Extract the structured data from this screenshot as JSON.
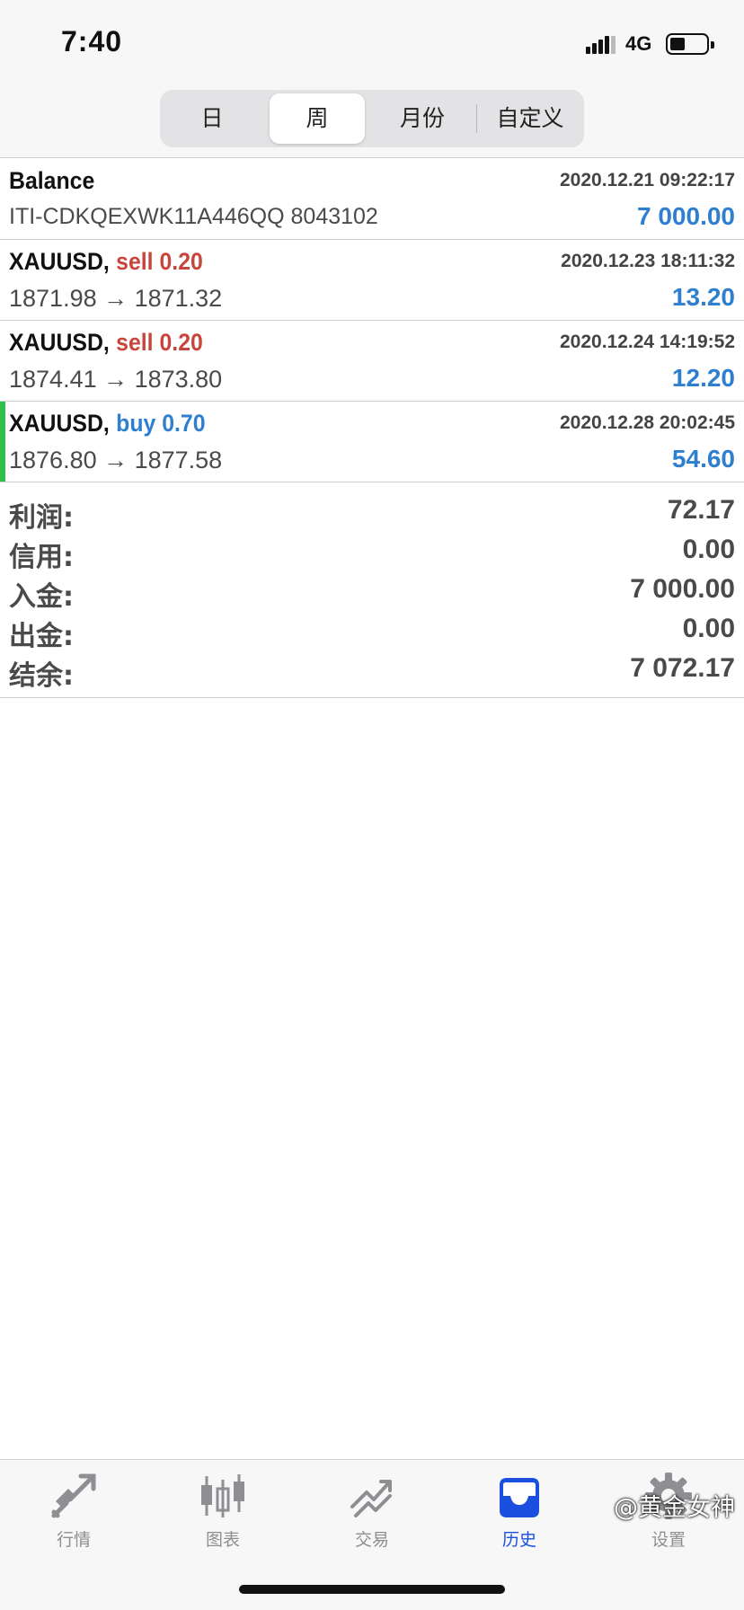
{
  "status": {
    "time": "7:40",
    "network": "4G"
  },
  "segments": [
    {
      "label": "日",
      "active": false
    },
    {
      "label": "周",
      "active": true
    },
    {
      "label": "月份",
      "active": false
    },
    {
      "label": "自定义",
      "active": false
    }
  ],
  "deals": [
    {
      "title": "Balance",
      "subtitle": "ITI-CDKQEXWK11A446QQ 8043102",
      "time": "2020.12.21 09:22:17",
      "amount": "7 000.00"
    },
    {
      "symbol": "XAUUSD,",
      "side": "sell 0.20",
      "prices": "1871.98 → 1871.32",
      "time": "2020.12.23 18:11:32",
      "amount": "13.20"
    },
    {
      "symbol": "XAUUSD,",
      "side": "sell 0.20",
      "prices": "1874.41 → 1873.80",
      "time": "2020.12.24 14:19:52",
      "amount": "12.20"
    },
    {
      "symbol": "XAUUSD,",
      "side": "buy 0.70",
      "prices": "1876.80 → 1877.58",
      "time": "2020.12.28 20:02:45",
      "amount": "54.60"
    }
  ],
  "summary": [
    {
      "label": "利润:",
      "value": "72.17"
    },
    {
      "label": "信用:",
      "value": "0.00"
    },
    {
      "label": "入金:",
      "value": "7 000.00"
    },
    {
      "label": "出金:",
      "value": "0.00"
    },
    {
      "label": "结余:",
      "value": "7 072.17"
    }
  ],
  "tabs": [
    {
      "label": "行情",
      "icon": "quotes-icon",
      "active": false
    },
    {
      "label": "图表",
      "icon": "chart-icon",
      "active": false
    },
    {
      "label": "交易",
      "icon": "trade-icon",
      "active": false
    },
    {
      "label": "历史",
      "icon": "history-icon",
      "active": true
    },
    {
      "label": "设置",
      "icon": "settings-icon",
      "active": false
    }
  ],
  "watermark": "@黄金女神",
  "colors": {
    "sell": "#c8453c",
    "buy": "#2f7fd0",
    "profit": "#2f7fd0",
    "active_tab": "#1a4fe0",
    "buy_marker": "#2fbf4a"
  }
}
